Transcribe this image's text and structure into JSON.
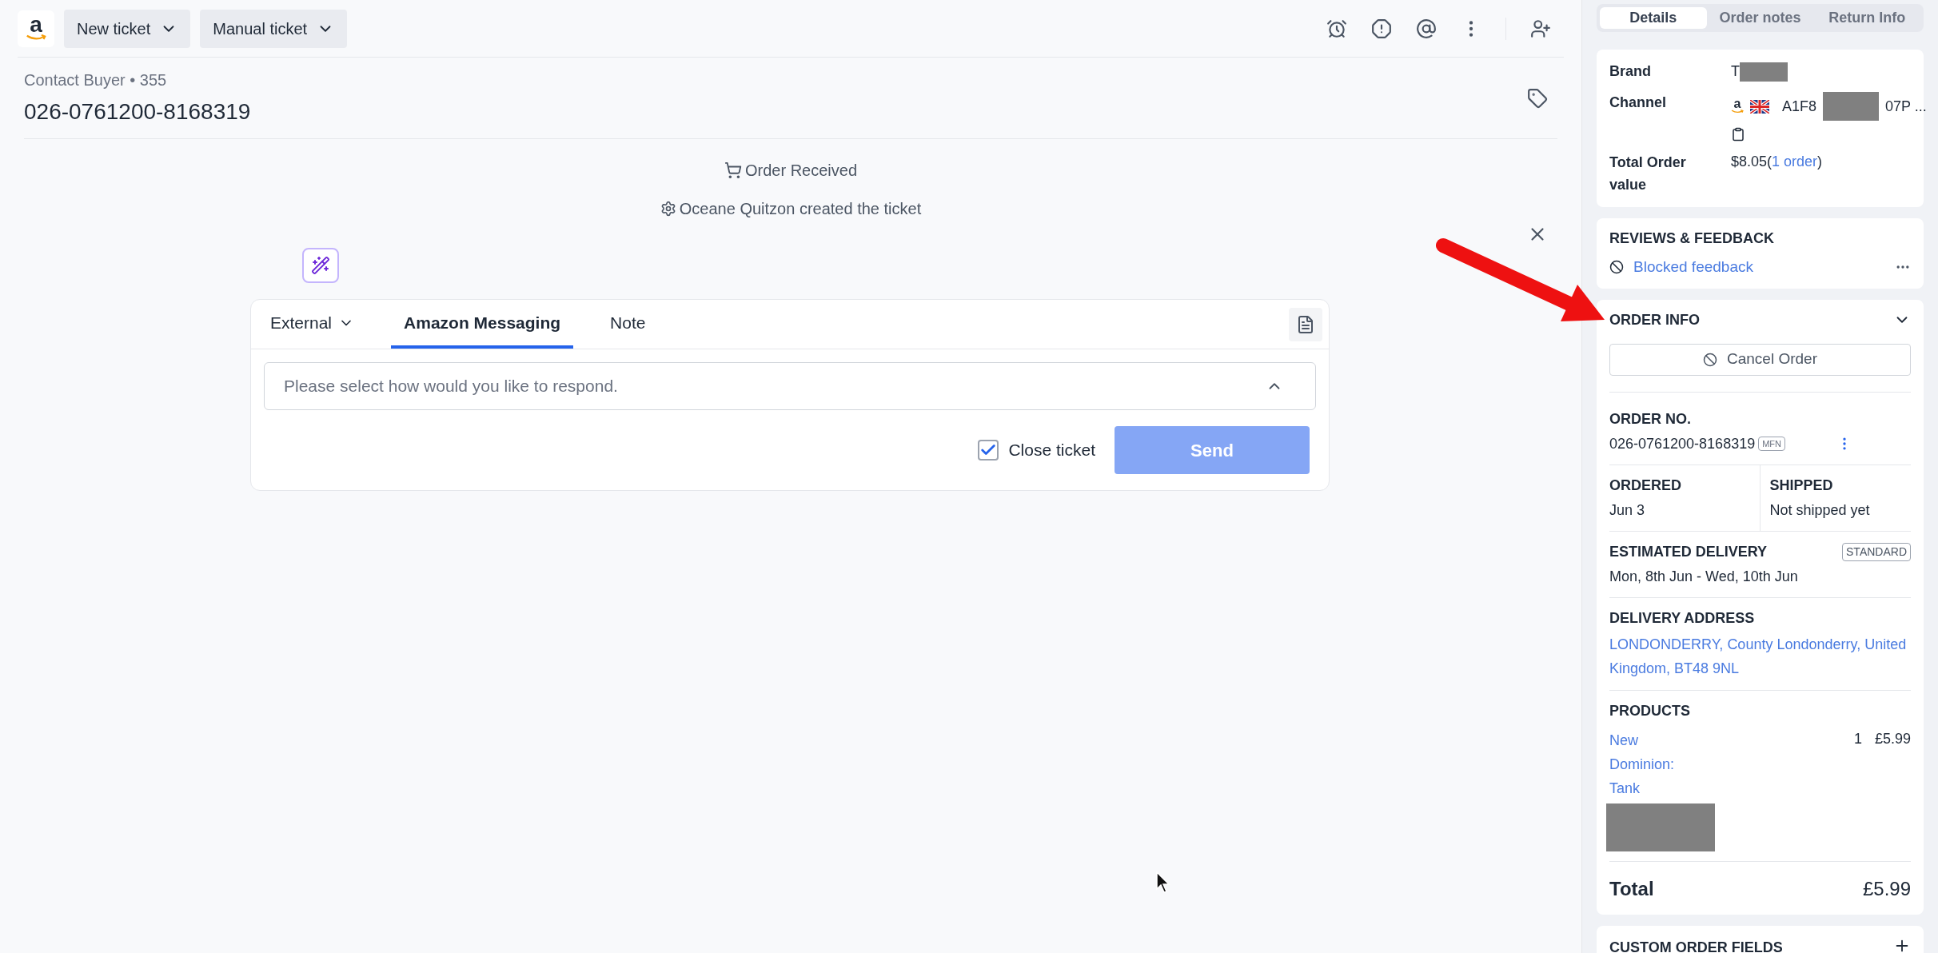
{
  "header": {
    "logo_text": "a",
    "buttons": [
      {
        "label": "New ticket"
      },
      {
        "label": "Manual ticket"
      }
    ]
  },
  "ticket": {
    "subtitle": "Contact Buyer • 355",
    "title": "026-0761200-8168319"
  },
  "timeline": [
    {
      "kind": "cart",
      "text": "Order Received"
    },
    {
      "kind": "gear",
      "text": "Oceane Quitzon created the ticket"
    }
  ],
  "composer": {
    "tabs": [
      {
        "label": "External",
        "kind": "dropdown",
        "selected": false
      },
      {
        "label": "Amazon Messaging",
        "kind": "tab",
        "selected": true
      },
      {
        "label": "Note",
        "kind": "tab",
        "selected": false
      }
    ],
    "select": {
      "placeholder": "Please select how would you like to respond."
    },
    "close_ticket": {
      "label": "Close ticket",
      "checked": true
    },
    "send": {
      "label": "Send",
      "disabled": true
    }
  },
  "sidebar": {
    "tabs": [
      {
        "label": "Details",
        "selected": true
      },
      {
        "label": "Order notes",
        "selected": false
      },
      {
        "label": "Return Info",
        "selected": false
      }
    ],
    "details": {
      "brand_label": "Brand",
      "brand_value": "T",
      "channel_label": "Channel",
      "channel_logo": "a",
      "channel_start": "A1F8",
      "channel_end": "07P ...",
      "total_label": "Total Order value",
      "total_value": "$8.05(",
      "total_link": "1 order",
      "total_close": ")"
    },
    "reviews": {
      "title": "REVIEWS & FEEDBACK",
      "link": "Blocked feedback"
    },
    "order_info": {
      "title": "ORDER INFO",
      "cancel": "Cancel Order",
      "order_no_label": "ORDER NO.",
      "order_no": "026-0761200-8168319",
      "order_badge": "MFN",
      "ordered_label": "ORDERED",
      "ordered": "Jun 3",
      "shipped_label": "SHIPPED",
      "shipped": "Not shipped yet",
      "delivery_label": "ESTIMATED DELIVERY",
      "delivery_badge": "STANDARD",
      "delivery": "Mon, 8th Jun - Wed, 10th Jun",
      "address_label": "DELIVERY ADDRESS",
      "address": "LONDONDERRY, County Londonderry, United Kingdom, BT48 9NL",
      "products_label": "PRODUCTS",
      "products": [
        {
          "name": "New Dominion: Tank",
          "qty": "1",
          "price": "£5.99"
        }
      ],
      "total_label": "Total",
      "total": "£5.99"
    },
    "custom_fields": {
      "title": "CUSTOM ORDER FIELDS"
    }
  }
}
